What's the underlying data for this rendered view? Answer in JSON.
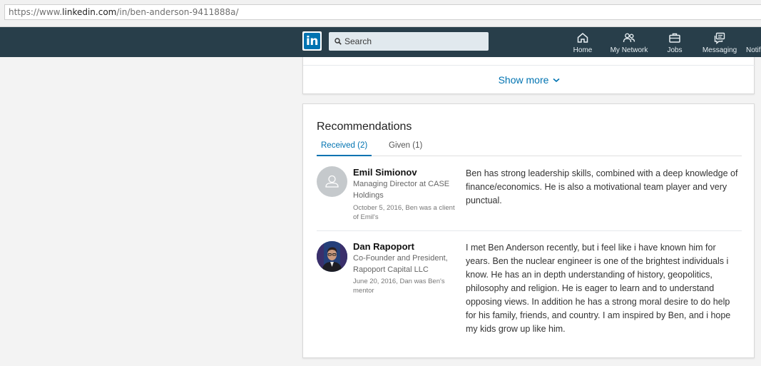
{
  "browser": {
    "url_prefix": "https://www.",
    "url_domain": "linkedin.com",
    "url_path": "/in/ben-anderson-9411888a/"
  },
  "nav": {
    "logo": "in",
    "search_placeholder": "Search",
    "items": [
      {
        "label": "Home",
        "icon": "home-icon"
      },
      {
        "label": "My Network",
        "icon": "network-icon"
      },
      {
        "label": "Jobs",
        "icon": "jobs-icon"
      },
      {
        "label": "Messaging",
        "icon": "messaging-icon"
      },
      {
        "label": "Notif",
        "icon": "notifications-icon"
      }
    ]
  },
  "accomplishments": {
    "show_more": "Show more"
  },
  "recommendations": {
    "title": "Recommendations",
    "tabs": [
      {
        "label": "Received (2)",
        "active": true
      },
      {
        "label": "Given (1)",
        "active": false
      }
    ],
    "items": [
      {
        "name": "Emil Simionov",
        "title": "Managing Director at CASE Holdings",
        "date": "October 5, 2016, Ben was a client of Emil's",
        "text": "Ben has strong leadership skills, combined with a deep knowledge of finance/economics. He is also a motivational team player and very punctual."
      },
      {
        "name": "Dan Rapoport",
        "title": "Co-Founder and President, Rapoport Capital LLC",
        "date": "June 20, 2016, Dan was Ben's mentor",
        "text": "I met Ben Anderson recently, but i feel like i have known him for years. Ben the nuclear engineer is one of the brightest individuals i know. He has an in depth understanding of history, geopolitics, philosophy and religion. He is eager to learn and to understand opposing views. In addition he has a strong moral desire to do help for his family, friends, and country. I am inspired by Ben, and i hope my kids grow up like him."
      }
    ]
  }
}
